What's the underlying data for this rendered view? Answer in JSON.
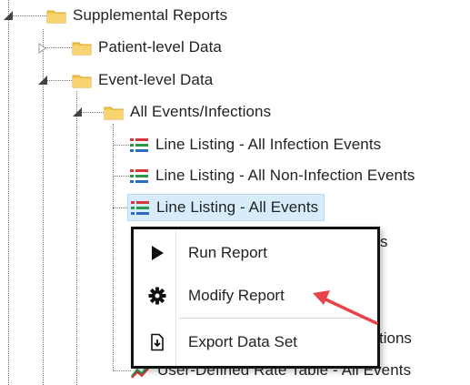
{
  "tree": {
    "supplemental_reports": "Supplemental Reports",
    "patient_level_data": "Patient-level Data",
    "event_level_data": "Event-level Data",
    "all_events_infections": "All Events/Infections",
    "line_listing_infection": "Line Listing - All Infection Events",
    "line_listing_non_infection": "Line Listing - All Non-Infection Events",
    "line_listing_all_events": "Line Listing - All Events",
    "partial_suffix_1": "s",
    "partial_suffix_2": "tions",
    "user_defined_rate_table": "User-Defined Rate Table - All Events"
  },
  "context_menu": {
    "run_report": "Run Report",
    "modify_report": "Modify Report",
    "export_data_set": "Export Data Set"
  },
  "colors": {
    "folder": "#f5c64a",
    "selection": "#d6ecfa",
    "arrow": "#e8434a",
    "report_icon_red": "#d9363e",
    "report_icon_green": "#2a9a4a",
    "report_icon_blue": "#2b6cc4"
  },
  "icons": {
    "folder": "folder-icon",
    "report": "report-list-icon",
    "run": "play-icon",
    "modify": "gear-icon",
    "export": "export-icon"
  }
}
